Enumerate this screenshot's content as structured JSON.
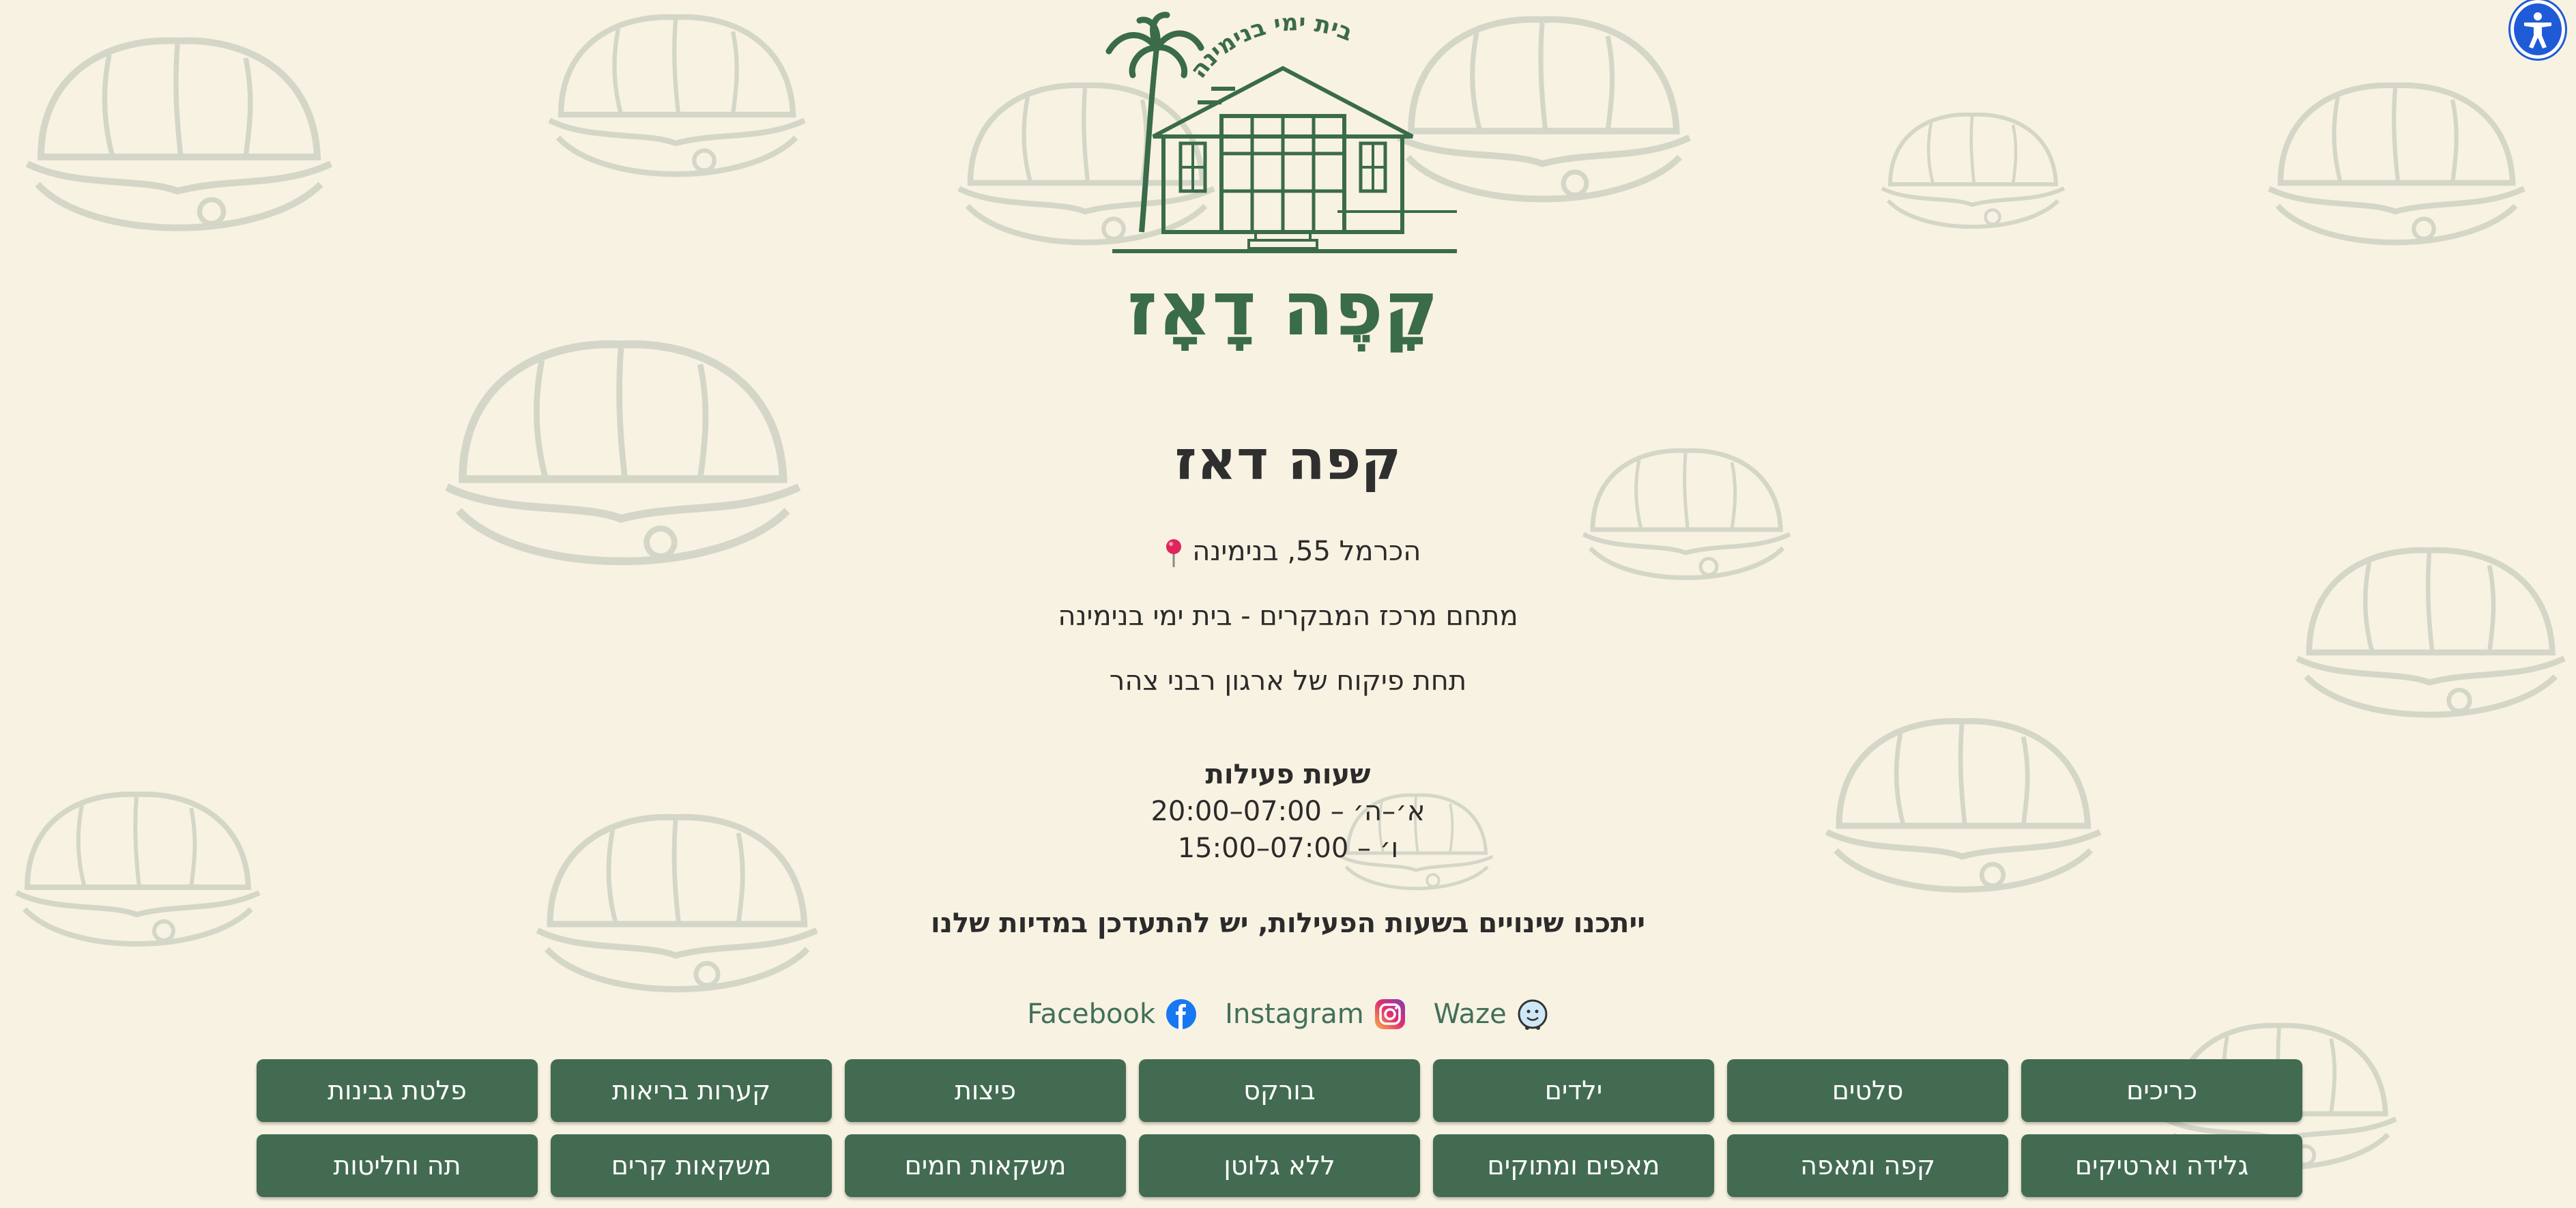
{
  "logo": {
    "arc_text": "בית ימי בנימינה",
    "wordmark": "קָפֶה דָאָז",
    "brand_color": "#3a6b4a"
  },
  "page": {
    "title": "קפה דאז",
    "address": "הכרמל 55, בנימינה",
    "location_note": "מתחם מרכז המבקרים - בית ימי בנימינה",
    "supervision": "תחת פיקוח של ארגון רבני צהר"
  },
  "hours": {
    "title": "שעות פעילות",
    "weekdays": "א׳–ה׳ – 07:00–20:00",
    "friday": "ו׳ – 07:00–15:00",
    "notice": "ייתכנו שינויים בשעות הפעילות, יש להתעדכן במדיות שלנו"
  },
  "social": {
    "waze": "Waze",
    "instagram": "Instagram",
    "facebook": "Facebook"
  },
  "menu": {
    "row1": [
      "כריכים",
      "סלטים",
      "ילדים",
      "בורקס",
      "פיצות",
      "קערות בריאות",
      "פלטת גבינות"
    ],
    "row2": [
      "גלידה וארטיקים",
      "קפה ומאפה",
      "מאפים ומתוקים",
      "ללא גלוטן",
      "משקאות חמים",
      "משקאות קרים",
      "תה וחליטות"
    ]
  },
  "icons": {
    "accessibility": "accessibility-icon",
    "pin": "map-pin-icon",
    "waze": "waze-icon",
    "instagram": "instagram-icon",
    "facebook": "facebook-icon"
  },
  "colors": {
    "background": "#f8f2e2",
    "button": "#436b52",
    "link": "#41705a",
    "accessibility": "#1f5bd6"
  }
}
